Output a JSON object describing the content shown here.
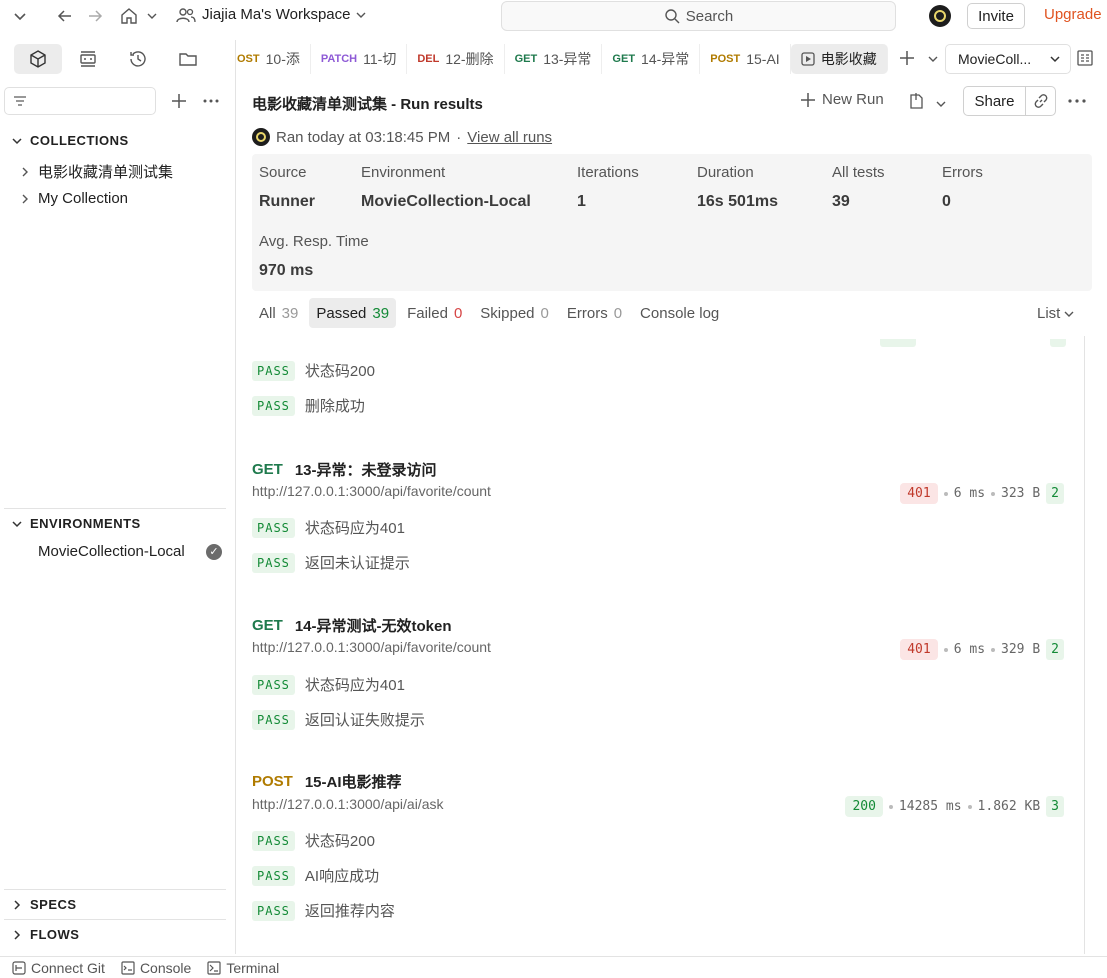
{
  "topbar": {
    "workspace": "Jiajia Ma's Workspace",
    "search_placeholder": "Search",
    "invite": "Invite",
    "upgrade": "Upgrade"
  },
  "tabs": [
    {
      "method": "OST",
      "label": "10-添",
      "method_color": "#b07b00"
    },
    {
      "method": "PATCH",
      "label": "11-切",
      "method_color": "#8e5ad6"
    },
    {
      "method": "DEL",
      "label": "12-删除",
      "method_color": "#c0392b"
    },
    {
      "method": "GET",
      "label": "13-异常",
      "method_color": "#1f7a4d"
    },
    {
      "method": "GET",
      "label": "14-异常",
      "method_color": "#1f7a4d"
    },
    {
      "method": "POST",
      "label": "15-AI",
      "method_color": "#b07b00"
    },
    {
      "method": "",
      "label": "电影收藏",
      "method_color": ""
    }
  ],
  "env_select": "MovieColl...",
  "sidebar": {
    "collections_title": "COLLECTIONS",
    "collections": [
      "电影收藏清单测试集",
      "My Collection"
    ],
    "environments_title": "ENVIRONMENTS",
    "environments": [
      "MovieCollection-Local"
    ],
    "specs_title": "SPECS",
    "flows_title": "FLOWS"
  },
  "run": {
    "title": "电影收藏清单测试集 - Run results",
    "new_run": "New Run",
    "share": "Share",
    "ran_at": "Ran today at 03:18:45 PM",
    "separator": "·",
    "view_all": "View all runs"
  },
  "summary": [
    {
      "label": "Source",
      "value": "Runner"
    },
    {
      "label": "Environment",
      "value": "MovieCollection-Local"
    },
    {
      "label": "Iterations",
      "value": "1"
    },
    {
      "label": "Duration",
      "value": "16s 501ms"
    },
    {
      "label": "All tests",
      "value": "39"
    },
    {
      "label": "Errors",
      "value": "0"
    },
    {
      "label": "Avg. Resp. Time",
      "value": "970 ms"
    }
  ],
  "filters": [
    {
      "label": "All",
      "count": "39"
    },
    {
      "label": "Passed",
      "count": "39"
    },
    {
      "label": "Failed",
      "count": "0"
    },
    {
      "label": "Skipped",
      "count": "0"
    },
    {
      "label": "Errors",
      "count": "0"
    },
    {
      "label": "Console log",
      "count": ""
    }
  ],
  "list_toggle": "List",
  "pass_label": "PASS",
  "orphan_tests": [
    "状态码200",
    "删除成功"
  ],
  "requests": [
    {
      "method": "GET",
      "name": "13-异常：未登录访问",
      "url": "http://127.0.0.1:3000/api/favorite/count",
      "status": "401",
      "time": "6 ms",
      "size": "323 B",
      "tests": "2",
      "assertions": [
        "状态码应为401",
        "返回未认证提示"
      ]
    },
    {
      "method": "GET",
      "name": "14-异常测试-无效token",
      "url": "http://127.0.0.1:3000/api/favorite/count",
      "status": "401",
      "time": "6 ms",
      "size": "329 B",
      "tests": "2",
      "assertions": [
        "状态码应为401",
        "返回认证失败提示"
      ]
    },
    {
      "method": "POST",
      "name": "15-AI电影推荐",
      "url": "http://127.0.0.1:3000/api/ai/ask",
      "status": "200",
      "time": "14285 ms",
      "size": "1.862 KB",
      "tests": "3",
      "assertions": [
        "状态码200",
        "AI响应成功",
        "返回推荐内容"
      ]
    }
  ],
  "statusbar": {
    "connect_git": "Connect Git",
    "console": "Console",
    "terminal": "Terminal"
  }
}
